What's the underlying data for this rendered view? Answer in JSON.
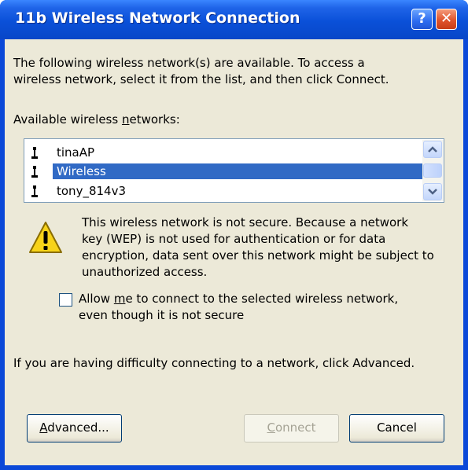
{
  "window": {
    "title": "11b Wireless Network Connection",
    "help_glyph": "?",
    "close_glyph": "✕"
  },
  "intro": {
    "line1": "The following wireless network(s) are available. To access a",
    "line2": "wireless network, select it from the list, and then click Connect."
  },
  "networks_label": {
    "before": "Available wireless ",
    "mnemonic": "n",
    "after": "etworks:"
  },
  "networks": {
    "items": [
      "tinaAP",
      "Wireless",
      "tony_814v3"
    ],
    "selected": "Wireless"
  },
  "warning": {
    "line1": "This wireless network is not secure. Because a network",
    "line2": "key (WEP) is not used for authentication or for data",
    "line3": "encryption, data sent over this network might be subject to",
    "line4": "unauthorized access."
  },
  "allow_checkbox": {
    "before": "Allow ",
    "mnemonic": "m",
    "after": "e to connect to the selected wireless network,",
    "line2": "even though it is not secure",
    "checked": false
  },
  "help_text": "If you are having difficulty connecting to a network, click Advanced.",
  "buttons": {
    "advanced": {
      "mnemonic": "A",
      "rest": "dvanced..."
    },
    "connect": {
      "mnemonic": "C",
      "rest": "onnect",
      "enabled": false
    },
    "cancel": "Cancel"
  },
  "colors": {
    "titlebar": "#0a50d8",
    "dialog_bg": "#ece9d8",
    "selection": "#316ac5"
  }
}
